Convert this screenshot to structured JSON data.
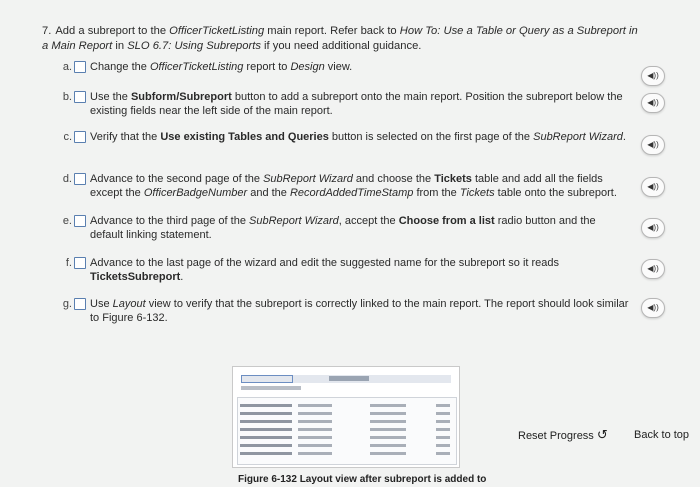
{
  "intro": {
    "number": "7.",
    "p1": "Add a subreport to the ",
    "p2": "OfficerTicketListing",
    "p3": " main report. Refer back to ",
    "p4": "How To: Use a Table or Query as a Subreport in a Main Report",
    "p5": " in ",
    "p6": "SLO 6.7: Using Subreports",
    "p7": " if you need additional guidance."
  },
  "steps": [
    {
      "letter": "a.",
      "parts": [
        "Change the ",
        "OfficerTicketListing",
        " report to ",
        "Design",
        " view."
      ]
    },
    {
      "letter": "b.",
      "parts": [
        "Use the ",
        "Subform/Subreport",
        " button to add a subreport onto the main report. Position the subreport below the existing fields near the left side of the main report."
      ]
    },
    {
      "letter": "c.",
      "parts": [
        "Verify that the ",
        "Use existing Tables and Queries",
        " button is selected on the first page of the ",
        "SubReport Wizard",
        "."
      ]
    },
    {
      "letter": "d.",
      "parts": [
        "Advance to the second page of the ",
        "SubReport Wizard",
        " and choose the ",
        "Tickets",
        " table and add all the fields except the ",
        "OfficerBadgeNumber",
        " and the ",
        "RecordAddedTimeStamp",
        " from the ",
        "Tickets",
        " table onto the subreport."
      ]
    },
    {
      "letter": "e.",
      "parts": [
        "Advance to the third page of the ",
        "SubReport Wizard",
        ", accept the ",
        "Choose from a list",
        " radio button and the default linking statement."
      ]
    },
    {
      "letter": "f.",
      "parts": [
        "Advance to the last page of the wizard and edit the suggested name for the subreport so it reads ",
        "TicketsSubreport",
        "."
      ]
    },
    {
      "letter": "g.",
      "parts": [
        "Use ",
        "Layout",
        " view to verify that the subreport is correctly linked to the main report. The report should look similar to Figure 6-132."
      ]
    }
  ],
  "audio_label": "◀))",
  "figure_caption": "Figure 6-132 Layout view after subreport is added to",
  "reset_label": "Reset Progress",
  "back_label": "Back to top"
}
